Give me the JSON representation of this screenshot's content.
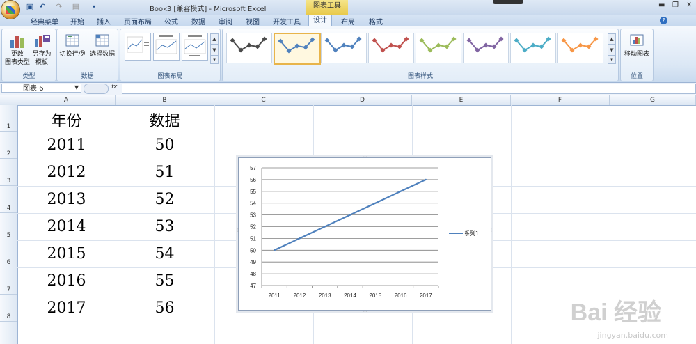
{
  "window": {
    "title": "Book3  [兼容模式] - Microsoft Excel",
    "context_tab": "图表工具"
  },
  "ribbon": {
    "tabs": [
      "经典菜单",
      "开始",
      "插入",
      "页面布局",
      "公式",
      "数据",
      "审阅",
      "视图",
      "开发工具",
      "设计",
      "布局",
      "格式"
    ],
    "active_tab": "设计",
    "groups": {
      "type": {
        "label": "类型",
        "change_type_label": "更改\n图表类型",
        "save_template_label": "另存为\n模板"
      },
      "data": {
        "label": "数据",
        "switch_label": "切换行/列",
        "select_label": "选择数据"
      },
      "layout": {
        "label": "图表布局"
      },
      "styles": {
        "label": "图表样式",
        "colors": [
          "#4a4a4a",
          "#4f81bd",
          "#4f81bd",
          "#c0504d",
          "#9bbb59",
          "#8064a2",
          "#4bacc6",
          "#f79646"
        ],
        "selected_index": 1
      },
      "location": {
        "label": "位置",
        "move_label": "移动图表"
      }
    }
  },
  "formula_bar": {
    "name_box": "图表 6",
    "fx": "fx",
    "formula": ""
  },
  "columns": [
    "A",
    "B",
    "C",
    "D",
    "E",
    "F",
    "G"
  ],
  "rows": [
    "1",
    "2",
    "3",
    "4",
    "5",
    "6",
    "7",
    "8"
  ],
  "cells": {
    "A": [
      "年份",
      "2011",
      "2012",
      "2013",
      "2014",
      "2015",
      "2016",
      "2017"
    ],
    "B": [
      "数据",
      "50",
      "51",
      "52",
      "53",
      "54",
      "55",
      "56"
    ]
  },
  "chart_data": {
    "type": "line",
    "categories": [
      "2011",
      "2012",
      "2013",
      "2014",
      "2015",
      "2016",
      "2017"
    ],
    "series": [
      {
        "name": "系列1",
        "values": [
          50,
          51,
          52,
          53,
          54,
          55,
          56
        ],
        "color": "#4f81bd"
      }
    ],
    "ylim": [
      47,
      57
    ],
    "yticks": [
      47,
      48,
      49,
      50,
      51,
      52,
      53,
      54,
      55,
      56,
      57
    ],
    "grid": true,
    "legend": "right",
    "title": "",
    "xlabel": "",
    "ylabel": ""
  },
  "watermark": {
    "brand": "Bai 经验",
    "url": "jingyan.baidu.com"
  }
}
